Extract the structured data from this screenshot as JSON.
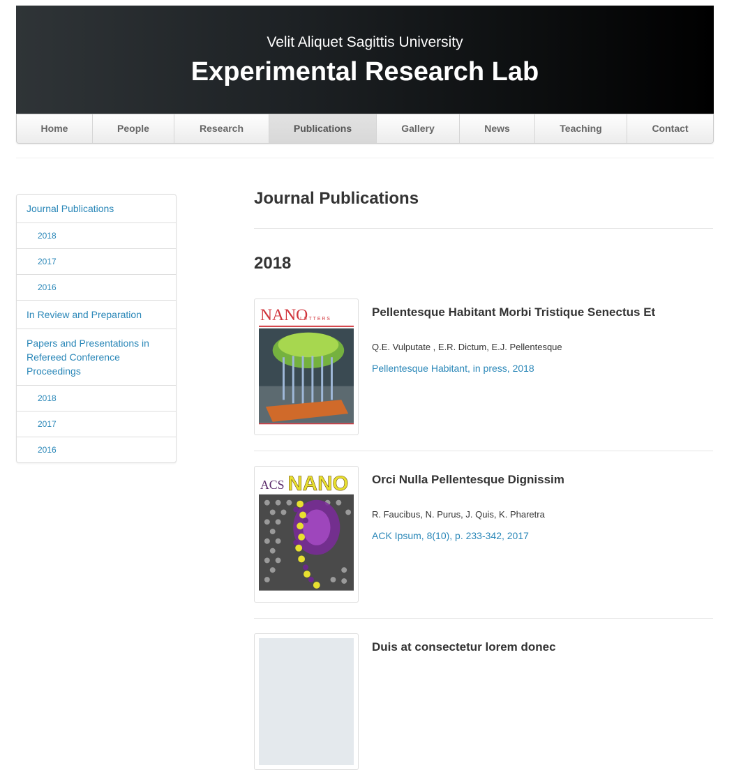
{
  "header": {
    "university": "Velit Aliquet Sagittis University",
    "lab": "Experimental Research Lab"
  },
  "nav": {
    "items": [
      "Home",
      "People",
      "Research",
      "Publications",
      "Gallery",
      "News",
      "Teaching",
      "Contact"
    ],
    "active": "Publications"
  },
  "sidebar": {
    "items": [
      {
        "label": "Journal Publications"
      },
      {
        "label": "2018"
      },
      {
        "label": "2017"
      },
      {
        "label": "2016"
      },
      {
        "label": "In Review and Preparation"
      },
      {
        "label": "Papers and Presentations in Refereed Conference Proceedings"
      },
      {
        "label": "2018"
      },
      {
        "label": "2017"
      },
      {
        "label": "2016"
      }
    ]
  },
  "main": {
    "title": "Journal Publications",
    "year": "2018",
    "pubs": [
      {
        "title": "Pellentesque Habitant Morbi Tristique Senectus Et",
        "authors": "Q.E. Vulputate , E.R. Dictum, E.J. Pellentesque",
        "venue": "Pellentesque Habitant, in press, 2018",
        "cover": {
          "journal": "NANO",
          "journal_suffix": "LETTERS"
        }
      },
      {
        "title": "Orci Nulla Pellentesque Dignissim",
        "authors": "R. Faucibus, N. Purus, J. Quis, K. Pharetra",
        "venue": "ACK Ipsum, 8(10), p. 233-342, 2017",
        "cover": {
          "journal": "NANO",
          "journal_prefix": "ACS"
        }
      },
      {
        "title": "Duis at consectetur lorem donec",
        "authors": "",
        "venue": ""
      }
    ]
  },
  "colors": {
    "link": "#2a87b8",
    "header_dark": "#0c0e0f",
    "nano_letters_red": "#d0343b",
    "acs_nano_yellow": "#e8e030"
  }
}
